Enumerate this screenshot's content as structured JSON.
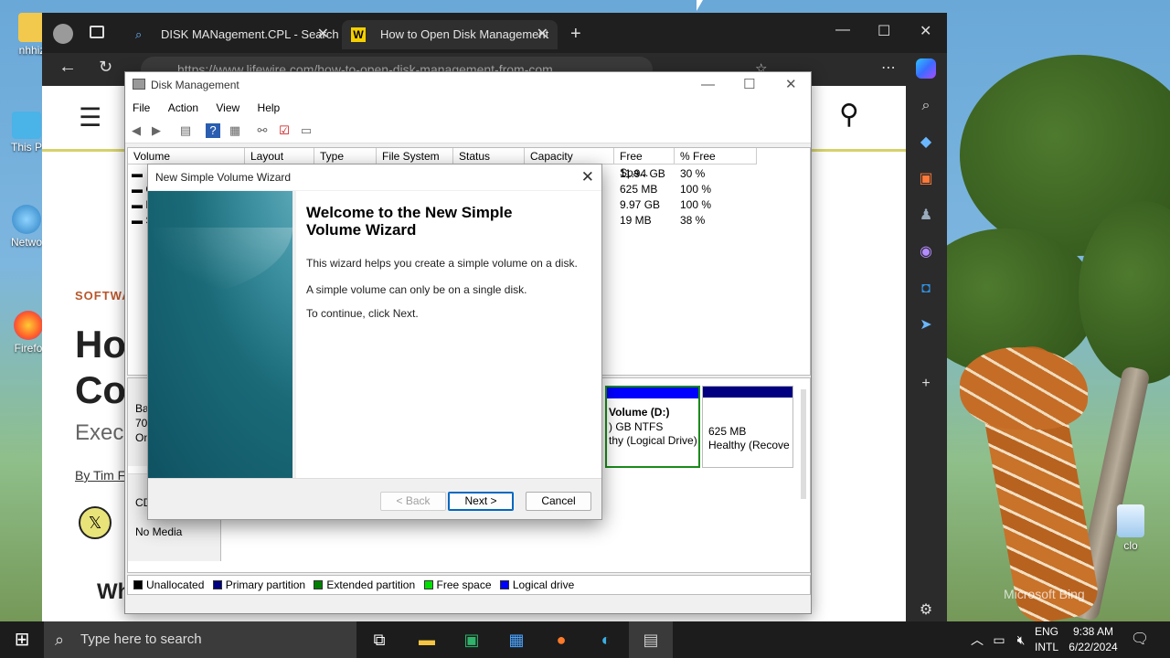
{
  "desktop": {
    "icons": [
      {
        "label": "nhhiz",
        "name": "user-folder"
      },
      {
        "label": "This P",
        "name": "this-pc"
      },
      {
        "label": "Netwo",
        "name": "network"
      },
      {
        "label": "Firefo",
        "name": "firefox"
      },
      {
        "label": "clo",
        "name": "recycle-bin"
      }
    ],
    "watermark": "Microsoft Bing"
  },
  "browser": {
    "tabs": [
      {
        "label": "DISK MANagement.CPL - Search",
        "close": "✕"
      },
      {
        "label": "How to Open Disk Management",
        "close": "✕"
      }
    ],
    "new_tab": "+",
    "url": "https://www.lifewire.com/how-to-open-disk-management-from-com...",
    "page": {
      "category": "SOFTWA",
      "title_line1": "Ho",
      "title_line2": "Co",
      "subtitle": "Exec",
      "byline": "By Tim F",
      "section": "Wh"
    }
  },
  "disk_management": {
    "title": "Disk Management",
    "menu": [
      "File",
      "Action",
      "View",
      "Help"
    ],
    "columns": [
      "Volume",
      "Layout",
      "Type",
      "File System",
      "Status",
      "Capacity",
      "Free Spa...",
      "% Free"
    ],
    "rows": [
      {
        "free": "11.94 GB",
        "pct": "30 %"
      },
      {
        "free": "625 MB",
        "pct": "100 %"
      },
      {
        "free": "9.97 GB",
        "pct": "100 %"
      },
      {
        "free": "19 MB",
        "pct": "38 %"
      }
    ],
    "row_letters": [
      "",
      "C",
      "N",
      "S"
    ],
    "graph": {
      "disk0_label": "Bas",
      "disk0_size": "70.",
      "disk0_status": "On",
      "volume_d_name": "Volume  (D:)",
      "volume_d_fs": ") GB NTFS",
      "volume_d_status": "thy (Logical Drive)",
      "recovery_size": "625 MB",
      "recovery_status": "Healthy (Recove",
      "cd_label": "CD",
      "cd_media": "No Media"
    },
    "legend": [
      {
        "label": "Unallocated",
        "color": "#000000"
      },
      {
        "label": "Primary partition",
        "color": "#000080"
      },
      {
        "label": "Extended partition",
        "color": "#008000"
      },
      {
        "label": "Free space",
        "color": "#00e000"
      },
      {
        "label": "Logical drive",
        "color": "#0000ff"
      }
    ]
  },
  "wizard": {
    "title": "New Simple Volume Wizard",
    "heading_line1": "Welcome to the New Simple",
    "heading_line2": "Volume Wizard",
    "para1": "This wizard helps you create a simple volume on a disk.",
    "para2": "A simple volume can only be on a single disk.",
    "para3": "To continue, click Next.",
    "back_label": "< Back",
    "next_label": "Next >",
    "cancel_label": "Cancel"
  },
  "taskbar": {
    "search_placeholder": "Type here to search",
    "lang_line1": "ENG",
    "lang_line2": "INTL",
    "time": "9:38 AM",
    "date": "6/22/2024"
  }
}
